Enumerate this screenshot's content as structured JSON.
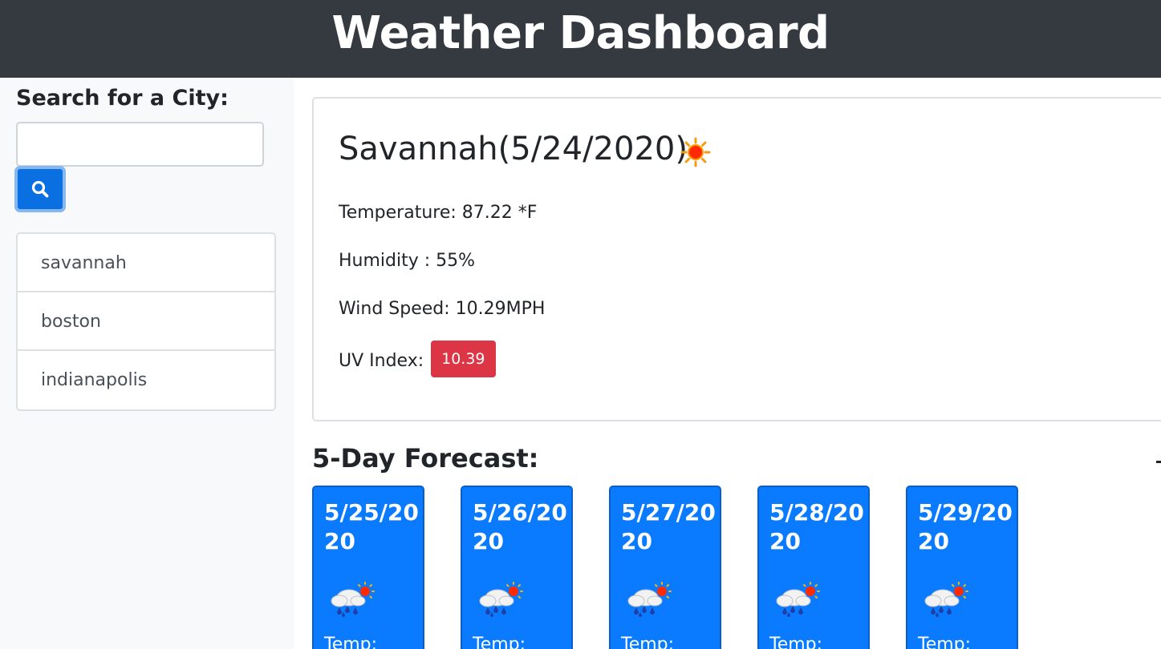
{
  "header": {
    "title": "Weather Dashboard"
  },
  "sidebar": {
    "search_label": "Search for a City:",
    "search_value": "",
    "search_placeholder": "",
    "search_button_icon": "search-icon",
    "cities": [
      {
        "label": "savannah"
      },
      {
        "label": "boston"
      },
      {
        "label": "indianapolis"
      }
    ]
  },
  "current": {
    "city_title": "Savannah(5/24/2020)",
    "icon": "sun-icon",
    "temperature": "Temperature: 87.22 *F",
    "humidity": "Humidity : 55%",
    "wind": "Wind Speed: 10.29MPH",
    "uv_label": "UV Index:",
    "uv_value": "10.39",
    "uv_color": "#dc3545"
  },
  "forecast": {
    "title": "5-Day Forecast:",
    "days": [
      {
        "date": "5/25/2020",
        "icon": "rain-sun-icon",
        "temp_label": "Temp:"
      },
      {
        "date": "5/26/2020",
        "icon": "rain-sun-icon",
        "temp_label": "Temp:"
      },
      {
        "date": "5/27/2020",
        "icon": "rain-sun-icon",
        "temp_label": "Temp:"
      },
      {
        "date": "5/28/2020",
        "icon": "rain-sun-icon",
        "temp_label": "Temp:"
      },
      {
        "date": "5/29/2020",
        "icon": "rain-sun-icon",
        "temp_label": "Temp:"
      }
    ]
  },
  "colors": {
    "header_bg": "#343a40",
    "primary": "#0a7bff",
    "danger": "#dc3545",
    "sidebar_bg": "#f8f9fa"
  }
}
